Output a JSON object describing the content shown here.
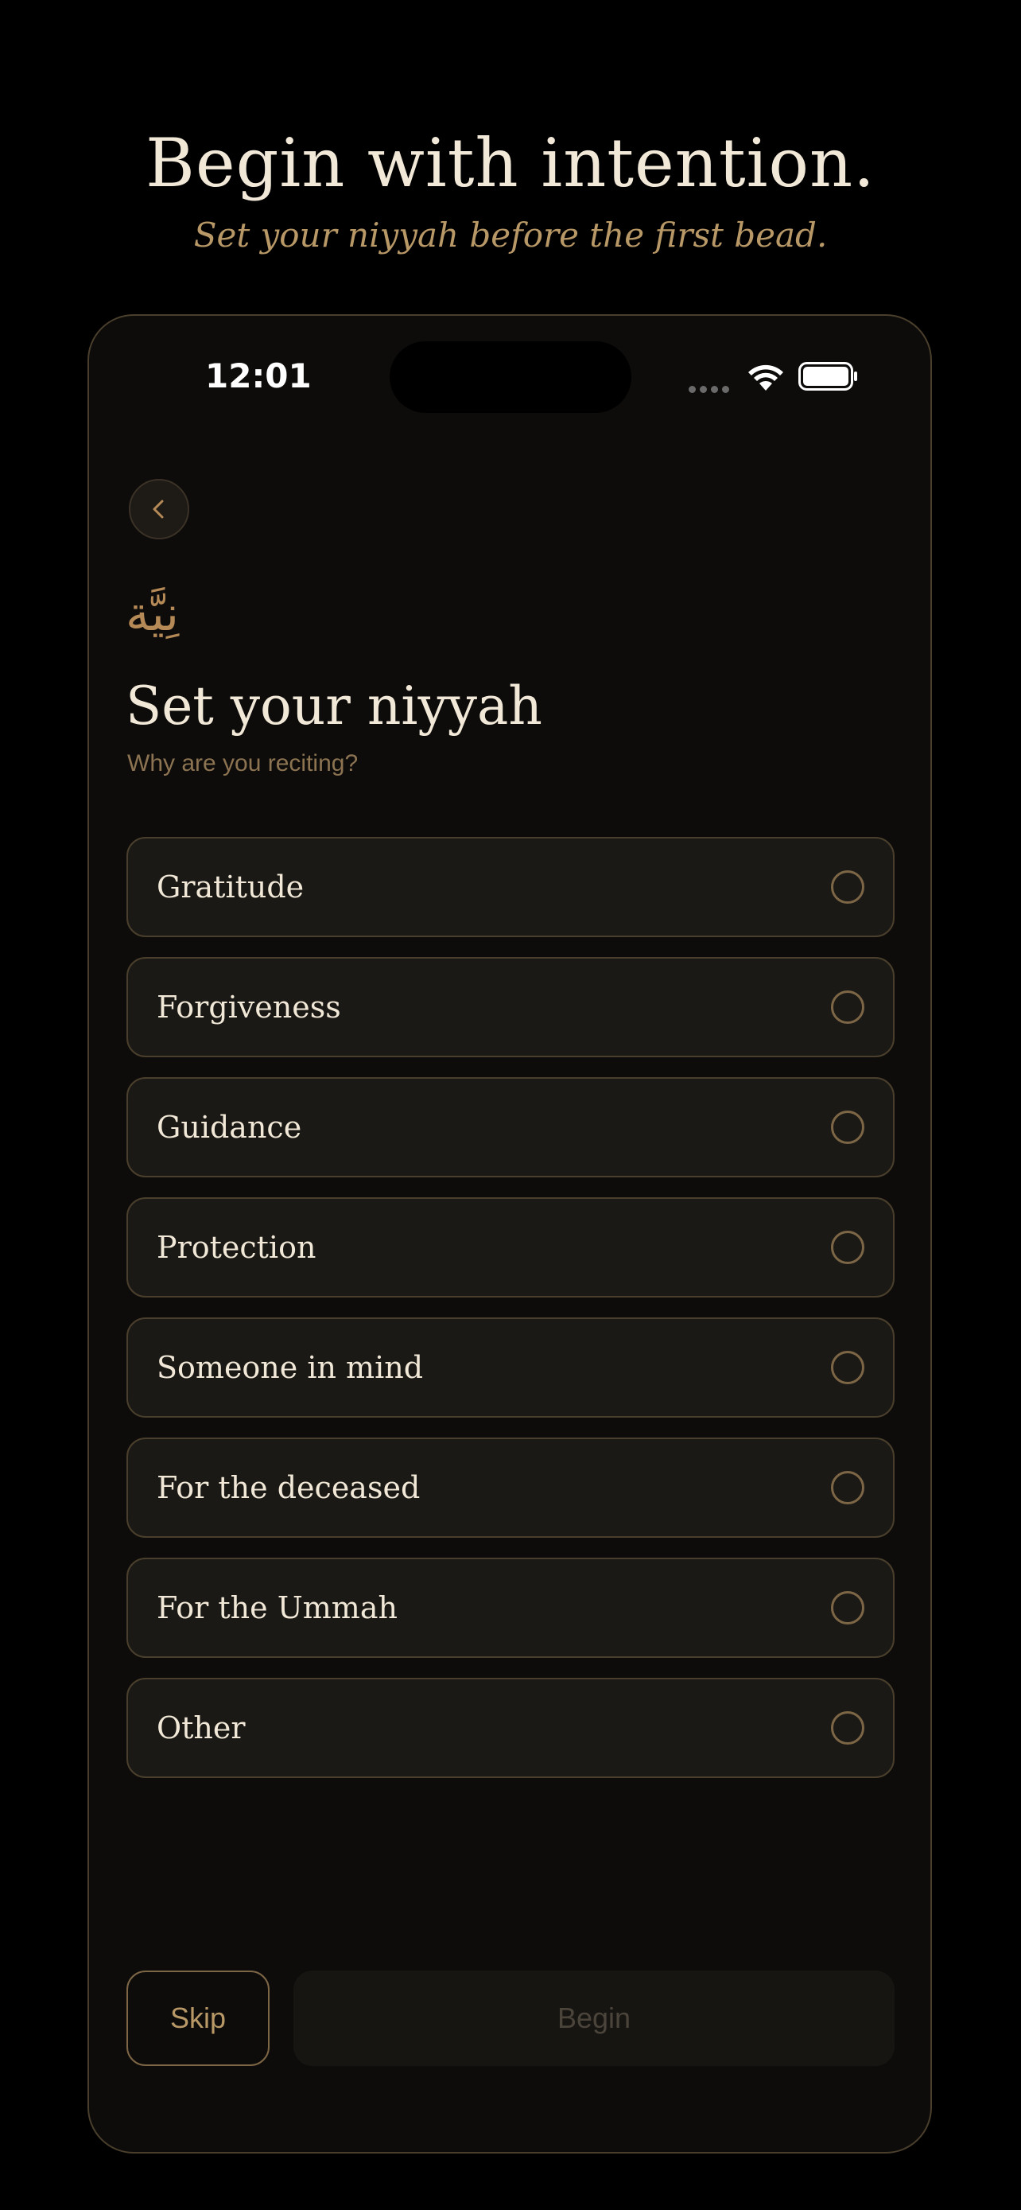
{
  "header": {
    "title": "Begin with intention.",
    "subtitle": "Set your niyyah before the first bead."
  },
  "status_bar": {
    "time": "12:01"
  },
  "screen": {
    "back_icon": "chevron-left-icon",
    "arabic_word": "نِيَّة",
    "title": "Set your niyyah",
    "subtitle": "Why are you reciting?",
    "options": [
      {
        "label": "Gratitude",
        "selected": false
      },
      {
        "label": "Forgiveness",
        "selected": false
      },
      {
        "label": "Guidance",
        "selected": false
      },
      {
        "label": "Protection",
        "selected": false
      },
      {
        "label": "Someone in mind",
        "selected": false
      },
      {
        "label": "For the deceased",
        "selected": false
      },
      {
        "label": "For the Ummah",
        "selected": false
      },
      {
        "label": "Other",
        "selected": false
      }
    ]
  },
  "actions": {
    "skip_label": "Skip",
    "begin_label": "Begin",
    "begin_enabled": false
  },
  "colors": {
    "background": "#000000",
    "accent_gold": "#b79866",
    "text_primary": "#f1e8d8",
    "card_border": "#4a3f2c"
  }
}
